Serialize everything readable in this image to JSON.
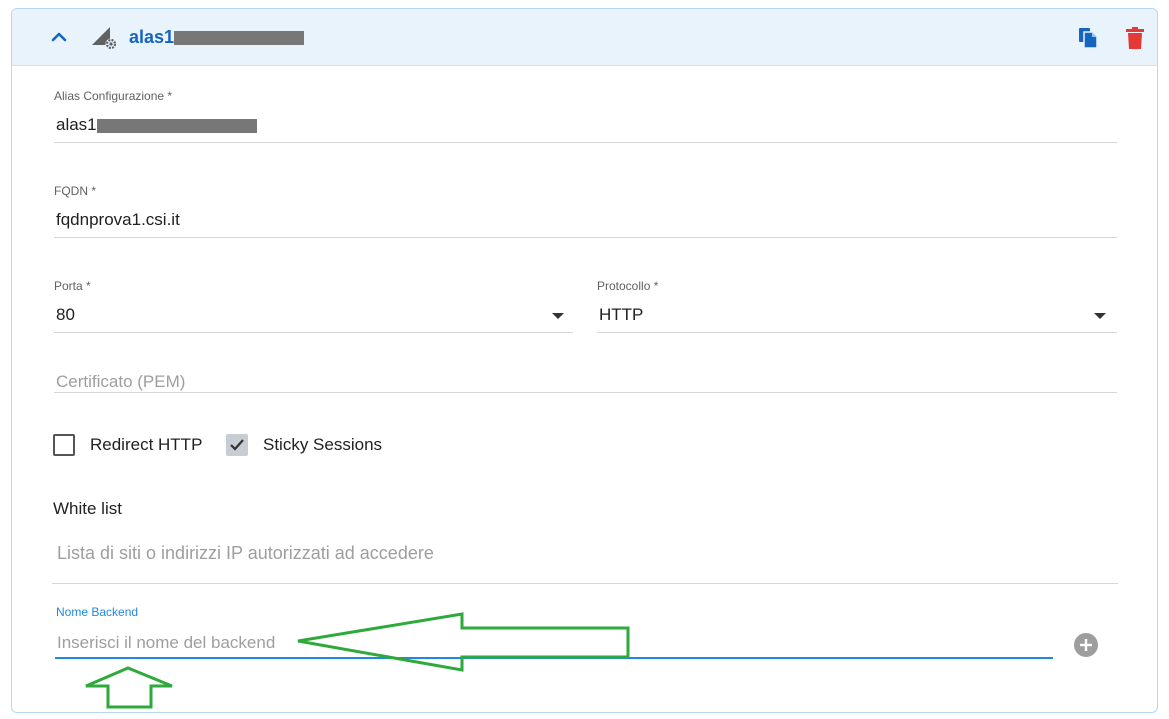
{
  "header": {
    "title": "alas1",
    "icons": {
      "toggle": "chevron-up-icon",
      "type": "load-balancer-gear-icon",
      "copy": "copy-icon",
      "delete": "trash-icon"
    },
    "colors": {
      "title": "#1565c0",
      "copy": "#1565c0",
      "delete": "#e53935"
    }
  },
  "form": {
    "alias": {
      "label": "Alias Configurazione *",
      "value": "alas1"
    },
    "fqdn": {
      "label": "FQDN *",
      "value": "fqdnprova1.csi.it"
    },
    "porta": {
      "label": "Porta *",
      "value": "80"
    },
    "protocollo": {
      "label": "Protocollo *",
      "value": "HTTP"
    },
    "certificato": {
      "placeholder": "Certificato (PEM)"
    },
    "redirect_http": {
      "label": "Redirect HTTP",
      "checked": false
    },
    "sticky_sessions": {
      "label": "Sticky Sessions",
      "checked": true
    },
    "white_list": {
      "title": "White list",
      "placeholder": "Lista di siti o indirizzi IP autorizzati ad accedere"
    },
    "nome_backend": {
      "label": "Nome Backend",
      "placeholder": "Inserisci il nome del backend",
      "value": ""
    },
    "add_button_icon": "plus-circle-icon"
  },
  "annotation_color": "#2eaa3c"
}
